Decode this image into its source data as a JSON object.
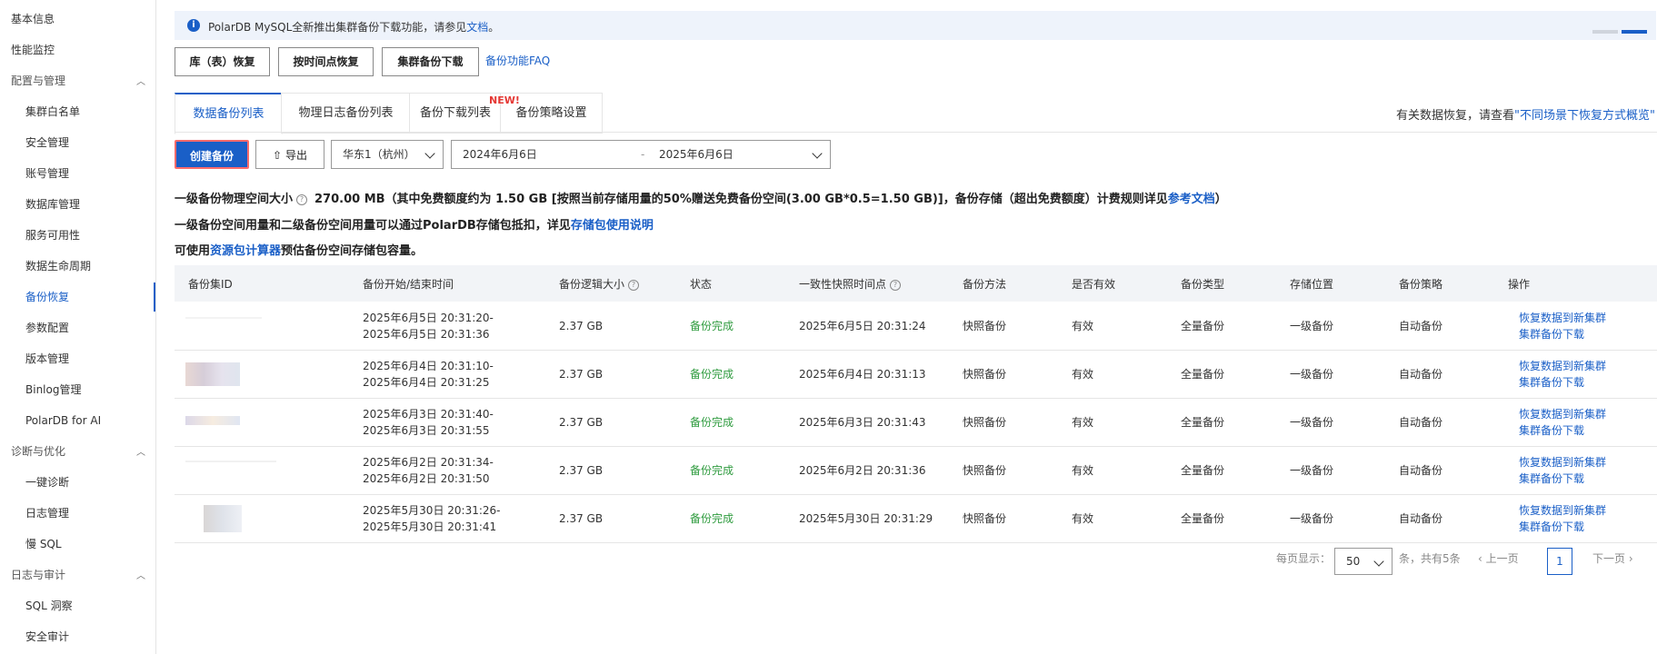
{
  "sidebar": {
    "items": [
      {
        "label": "基本信息"
      },
      {
        "label": "性能监控"
      },
      {
        "label": "配置与管理"
      },
      {
        "label": "集群白名单"
      },
      {
        "label": "安全管理"
      },
      {
        "label": "账号管理"
      },
      {
        "label": "数据库管理"
      },
      {
        "label": "服务可用性"
      },
      {
        "label": "数据生命周期"
      },
      {
        "label": "备份恢复"
      },
      {
        "label": "参数配置"
      },
      {
        "label": "版本管理"
      },
      {
        "label": "Binlog管理"
      },
      {
        "label": "PolarDB for AI"
      },
      {
        "label": "诊断与优化"
      },
      {
        "label": "一键诊断"
      },
      {
        "label": "日志管理"
      },
      {
        "label": "慢 SQL"
      },
      {
        "label": "日志与审计"
      },
      {
        "label": "SQL 洞察"
      },
      {
        "label": "安全审计"
      }
    ],
    "active": "备份恢复"
  },
  "notice": {
    "text": "PolarDB MySQL全新推出集群备份下载功能，请参见",
    "link": "文档",
    "end": "。"
  },
  "toolbar": {
    "restore_table": "库（表）恢复",
    "restore_time": "按时间点恢复",
    "cluster_download": "集群备份下载",
    "faq": "备份功能FAQ"
  },
  "tabs": [
    {
      "label": "数据备份列表"
    },
    {
      "label": "物理日志备份列表"
    },
    {
      "label": "备份下载列表"
    },
    {
      "label": "备份策略设置"
    }
  ],
  "new_badge": "NEW!",
  "help": {
    "text": "有关数据恢复，请查看",
    "link": "\"不同场景下恢复方式概览\""
  },
  "actions": {
    "create": "创建备份",
    "export": "导出"
  },
  "region": "华东1（杭州）",
  "date_range": {
    "start": "2024年6月6日",
    "sep": "-",
    "end": "2025年6月6日"
  },
  "info": {
    "line1_label": "一级备份物理空间大小",
    "line1_value": "270.00 MB（其中免费额度约为 1.50 GB [按照当前存储用量的50%赠送免费备份空间(3.00 GB*0.5=1.50 GB)]，备份存储（超出免费额度）计费规则详见",
    "line1_link": "参考文档",
    "line1_end": "）",
    "line2_text": "一级备份空间用量和二级备份空间用量可以通过PolarDB存储包抵扣，详见",
    "line2_link": "存储包使用说明",
    "line3_pre": "可使用",
    "line3_link": "资源包计算器",
    "line3_post": "预估备份空间存储包容量。"
  },
  "table": {
    "headers": [
      "备份集ID",
      "备份开始/结束时间",
      "备份逻辑大小",
      "状态",
      "一致性快照时间点",
      "备份方法",
      "是否有效",
      "备份类型",
      "存储位置",
      "备份策略",
      "操作"
    ],
    "rows": [
      {
        "start": "2025年6月5日 20:31:20-",
        "end": "2025年6月5日 20:31:36",
        "size": "2.37 GB",
        "status": "备份完成",
        "snapshot": "2025年6月5日 20:31:24",
        "method": "快照备份",
        "valid": "有效",
        "type": "全量备份",
        "location": "一级备份",
        "policy": "自动备份",
        "op1": "恢复数据到新集群",
        "op2": "集群备份下载"
      },
      {
        "start": "2025年6月4日 20:31:10-",
        "end": "2025年6月4日 20:31:25",
        "size": "2.37 GB",
        "status": "备份完成",
        "snapshot": "2025年6月4日 20:31:13",
        "method": "快照备份",
        "valid": "有效",
        "type": "全量备份",
        "location": "一级备份",
        "policy": "自动备份",
        "op1": "恢复数据到新集群",
        "op2": "集群备份下载"
      },
      {
        "start": "2025年6月3日 20:31:40-",
        "end": "2025年6月3日 20:31:55",
        "size": "2.37 GB",
        "status": "备份完成",
        "snapshot": "2025年6月3日 20:31:43",
        "method": "快照备份",
        "valid": "有效",
        "type": "全量备份",
        "location": "一级备份",
        "policy": "自动备份",
        "op1": "恢复数据到新集群",
        "op2": "集群备份下载"
      },
      {
        "start": "2025年6月2日 20:31:34-",
        "end": "2025年6月2日 20:31:50",
        "size": "2.37 GB",
        "status": "备份完成",
        "snapshot": "2025年6月2日 20:31:36",
        "method": "快照备份",
        "valid": "有效",
        "type": "全量备份",
        "location": "一级备份",
        "policy": "自动备份",
        "op1": "恢复数据到新集群",
        "op2": "集群备份下载"
      },
      {
        "start": "2025年5月30日 20:31:26-",
        "end": "2025年5月30日 20:31:41",
        "size": "2.37 GB",
        "status": "备份完成",
        "snapshot": "2025年5月30日 20:31:29",
        "method": "快照备份",
        "valid": "有效",
        "type": "全量备份",
        "location": "一级备份",
        "policy": "自动备份",
        "op1": "恢复数据到新集群",
        "op2": "集群备份下载"
      }
    ]
  },
  "pagination": {
    "per_page_label": "每页显示：",
    "per_page": "50",
    "total": "条，共有5条",
    "prev": "上一页",
    "page": "1",
    "next": "下一页"
  },
  "colors": {
    "accent": "#1a5fc7",
    "success": "#2e9b3e",
    "badge": "#e53935"
  }
}
